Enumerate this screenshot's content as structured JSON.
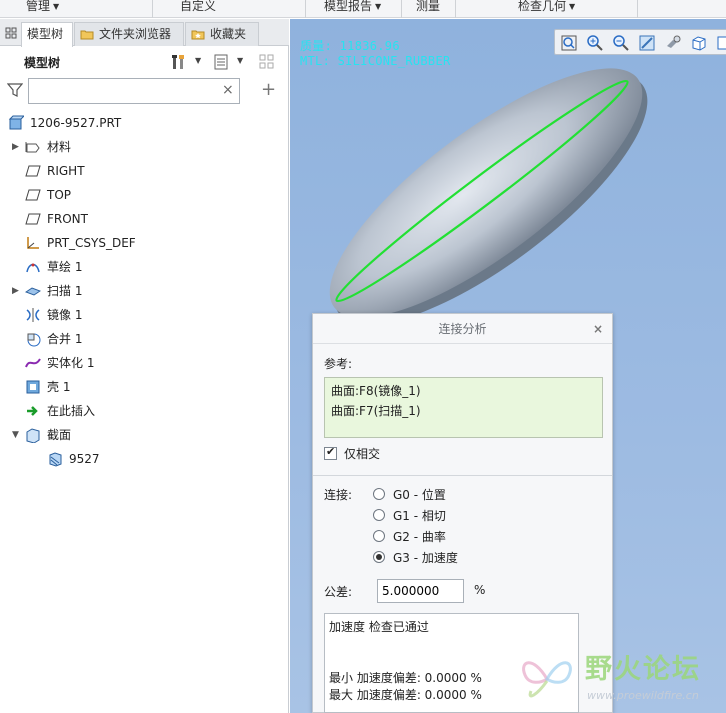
{
  "menubar": {
    "items": [
      {
        "label": "管理"
      },
      {
        "label": "自定义"
      },
      {
        "label": "模型报告"
      },
      {
        "label": "测量"
      },
      {
        "label": "检查几何"
      }
    ]
  },
  "left_panel": {
    "tabs": [
      {
        "label": "模型树",
        "icon": "model-tree-icon",
        "active": true
      },
      {
        "label": "文件夹浏览器",
        "icon": "folder-icon",
        "active": false
      },
      {
        "label": "收藏夹",
        "icon": "favorites-icon",
        "active": false
      }
    ],
    "toolbar_title": "模型树",
    "search": {
      "value": "",
      "placeholder": ""
    },
    "tree": [
      {
        "label": "1206-9527.PRT",
        "icon": "part-icon",
        "expand": "",
        "indent": 0
      },
      {
        "label": "材料",
        "icon": "material-icon",
        "expand": "▶",
        "indent": 1
      },
      {
        "label": "RIGHT",
        "icon": "datum-plane-icon",
        "expand": "",
        "indent": 1
      },
      {
        "label": "TOP",
        "icon": "datum-plane-icon",
        "expand": "",
        "indent": 1
      },
      {
        "label": "FRONT",
        "icon": "datum-plane-icon",
        "expand": "",
        "indent": 1
      },
      {
        "label": "PRT_CSYS_DEF",
        "icon": "csys-icon",
        "expand": "",
        "indent": 1
      },
      {
        "label": "草绘 1",
        "icon": "sketch-icon",
        "expand": "",
        "indent": 1
      },
      {
        "label": "扫描 1",
        "icon": "sweep-icon",
        "expand": "▶",
        "indent": 1
      },
      {
        "label": "镜像 1",
        "icon": "mirror-icon",
        "expand": "",
        "indent": 1
      },
      {
        "label": "合并 1",
        "icon": "merge-icon",
        "expand": "",
        "indent": 1
      },
      {
        "label": "实体化 1",
        "icon": "solidify-icon",
        "expand": "",
        "indent": 1
      },
      {
        "label": "壳 1",
        "icon": "shell-icon",
        "expand": "",
        "indent": 1
      },
      {
        "label": "在此插入",
        "icon": "insert-here-arrow-icon",
        "expand": "",
        "indent": 1
      },
      {
        "label": "截面",
        "icon": "section-icon",
        "expand": "▼",
        "indent": 1
      },
      {
        "label": "9527",
        "icon": "section-item-icon",
        "expand": "",
        "indent": 2
      }
    ]
  },
  "viewport": {
    "mass_line1": "质量: 11836.96",
    "mass_line2": "MTL: SILICONE_RUBBER",
    "colors": {
      "background": "#9dbbe2",
      "model": "#b9c3d0",
      "highlight_edge": "#22e033",
      "text": "#27e3f0"
    }
  },
  "dialog": {
    "title": "连接分析",
    "close": "×",
    "ref_label": "参考:",
    "references": [
      "曲面:F8(镜像_1)",
      "曲面:F7(扫描_1)"
    ],
    "only_tangent_label": "仅相交",
    "only_tangent_checked": true,
    "connection_label": "连接:",
    "options": [
      {
        "label": "G0 - 位置",
        "selected": false
      },
      {
        "label": "G1 - 相切",
        "selected": false
      },
      {
        "label": "G2 - 曲率",
        "selected": false
      },
      {
        "label": "G3 - 加速度",
        "selected": true
      }
    ],
    "tolerance_label": "公差:",
    "tolerance_value": "5.000000",
    "tolerance_unit": "%",
    "results": {
      "status": "加速度 检查已通过",
      "min": "最小 加速度偏差: 0.0000 %",
      "max": "最大 加速度偏差: 0.0000 %"
    }
  },
  "watermark": {
    "title": "野火论坛",
    "url": "www.proewildfire.cn"
  }
}
